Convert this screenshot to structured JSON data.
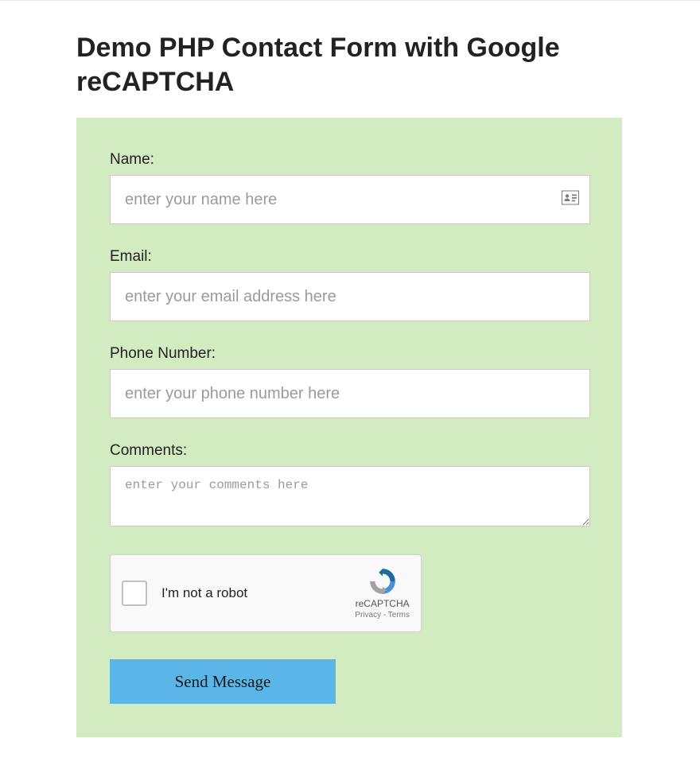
{
  "page": {
    "title": "Demo PHP Contact Form with Google reCAPTCHA"
  },
  "form": {
    "name": {
      "label": "Name:",
      "placeholder": "enter your name here",
      "value": ""
    },
    "email": {
      "label": "Email:",
      "placeholder": "enter your email address here",
      "value": ""
    },
    "phone": {
      "label": "Phone Number:",
      "placeholder": "enter your phone number here",
      "value": ""
    },
    "comments": {
      "label": "Comments:",
      "placeholder": "enter your comments here",
      "value": ""
    },
    "recaptcha": {
      "label": "I'm not a robot",
      "brand": "reCAPTCHA",
      "legal": "Privacy - Terms"
    },
    "submit": {
      "label": "Send Message"
    }
  }
}
